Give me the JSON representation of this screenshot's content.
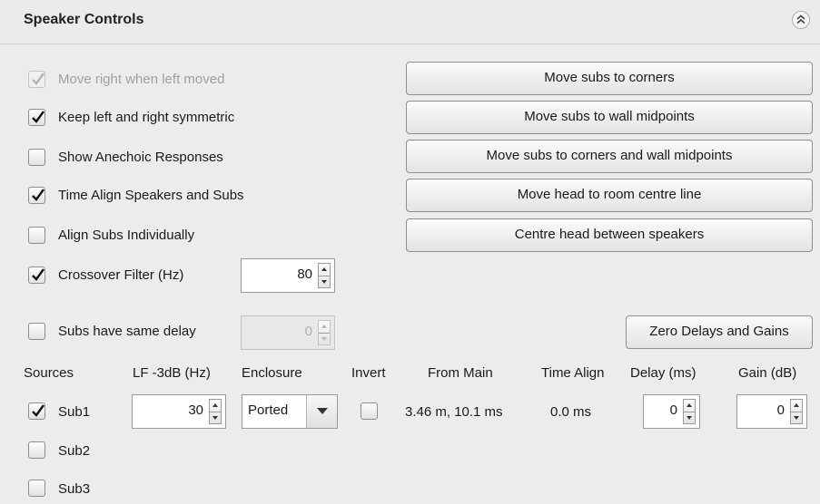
{
  "header": {
    "title": "Speaker Controls",
    "collapse_icon": "double-chevron-up-icon"
  },
  "options": {
    "move_right": {
      "label": "Move right when left moved",
      "checked": true,
      "disabled": true
    },
    "keep_symmetric": {
      "label": "Keep left and right symmetric",
      "checked": true
    },
    "show_anechoic": {
      "label": "Show Anechoic Responses",
      "checked": false
    },
    "time_align": {
      "label": "Time Align Speakers and Subs",
      "checked": true
    },
    "align_subs": {
      "label": "Align Subs Individually",
      "checked": false
    },
    "crossover": {
      "label": "Crossover Filter (Hz)",
      "checked": true,
      "value": "80"
    },
    "same_delay": {
      "label": "Subs have same delay",
      "checked": false,
      "value": "0"
    }
  },
  "buttons": {
    "corners": "Move subs to corners",
    "midpoints": "Move subs to wall midpoints",
    "corners_midpoints": "Move subs to corners and wall midpoints",
    "head_centre_line": "Move head to room centre line",
    "centre_head": "Centre head between speakers",
    "zero_delays": "Zero Delays and Gains"
  },
  "table": {
    "headers": {
      "sources": "Sources",
      "lf": "LF -3dB (Hz)",
      "enclosure": "Enclosure",
      "invert": "Invert",
      "from_main": "From Main",
      "time_align": "Time Align",
      "delay": "Delay (ms)",
      "gain": "Gain (dB)"
    },
    "sub1": {
      "label": "Sub1",
      "checked": true,
      "lf": "30",
      "enclosure": "Ported",
      "invert": false,
      "from_main": "3.46 m, 10.1 ms",
      "time_align": "0.0 ms",
      "delay": "0",
      "gain": "0"
    },
    "sub2": {
      "label": "Sub2",
      "checked": false
    },
    "sub3": {
      "label": "Sub3",
      "checked": false
    }
  }
}
